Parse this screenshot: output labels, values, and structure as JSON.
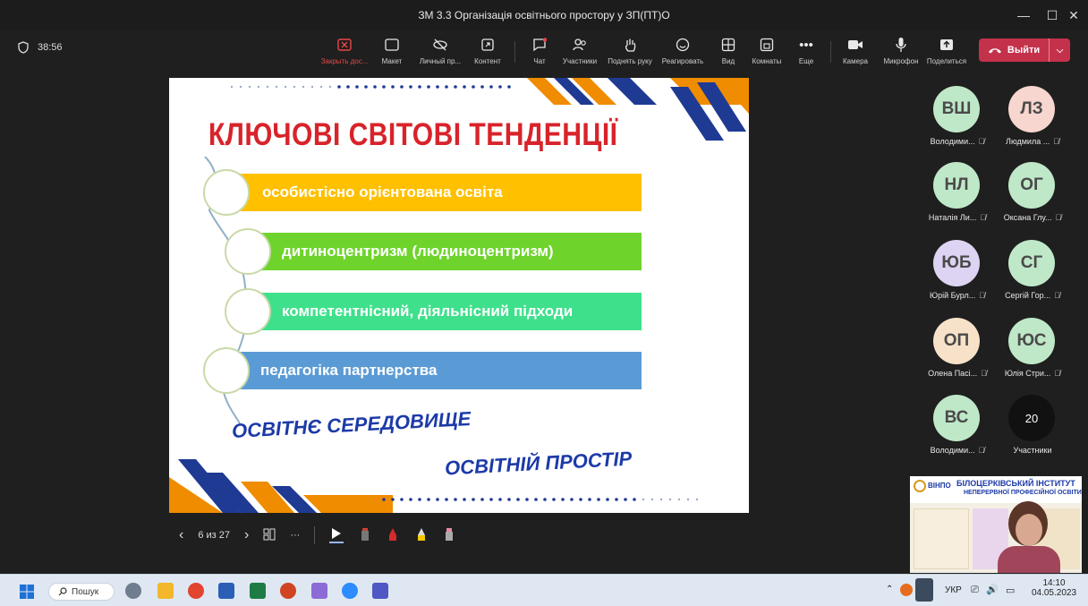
{
  "window": {
    "title": "ЗМ 3.3 Організація освітнього простору у ЗП(ПТ)О",
    "controls": [
      "—",
      "☐",
      "✕"
    ]
  },
  "toolbar": {
    "timer": "38:56",
    "buttons": [
      {
        "label": "Закрыть дос...",
        "icon": "close-share-icon"
      },
      {
        "label": "Макет",
        "icon": "layout-icon"
      },
      {
        "label": "Личный пр...",
        "icon": "eye-off-icon"
      },
      {
        "label": "Контент",
        "icon": "content-icon"
      },
      {
        "label": "Чат",
        "icon": "chat-icon"
      },
      {
        "label": "Участники",
        "icon": "participants-icon"
      },
      {
        "label": "Поднять руку",
        "icon": "hand-icon"
      },
      {
        "label": "Реагировать",
        "icon": "smile-icon"
      },
      {
        "label": "Вид",
        "icon": "grid-icon"
      },
      {
        "label": "Комнаты",
        "icon": "rooms-icon"
      },
      {
        "label": "Еще",
        "icon": "more-icon"
      },
      {
        "label": "Камера",
        "icon": "camera-icon"
      },
      {
        "label": "Микрофон",
        "icon": "mic-icon"
      },
      {
        "label": "Поделиться",
        "icon": "share-icon"
      }
    ],
    "leave_label": "Выйти"
  },
  "slide": {
    "heading": "КЛЮЧОВІ СВІТОВІ ТЕНДЕНЦІЇ",
    "items": [
      {
        "text": "особистісно орієнтована освіта",
        "color": "#ffc000"
      },
      {
        "text": "дитиноцентризм (людиноцентризм)",
        "color": "#6ed42c"
      },
      {
        "text": "компетентнісний, діяльнісний підходи",
        "color": "#3fe08c"
      },
      {
        "text": "педагогіка партнерства",
        "color": "#5b9bd5"
      }
    ],
    "phrase1": "ОСВІТНЄ СЕРЕДОВИЩЕ",
    "phrase2": "ОСВІТНІЙ ПРОСТІР"
  },
  "slide_controls": {
    "page": "6 из 27"
  },
  "participants": [
    {
      "initials": "ВШ",
      "name": "Володими...",
      "color": "#bfe8c8"
    },
    {
      "initials": "ЛЗ",
      "name": "Людмила ...",
      "color": "#f7d6cf"
    },
    {
      "initials": "НЛ",
      "name": "Наталія Ли...",
      "color": "#bfe8c8"
    },
    {
      "initials": "ОГ",
      "name": "Оксана Глу...",
      "color": "#bfe8c8"
    },
    {
      "initials": "ЮБ",
      "name": "Юрій Бурл...",
      "color": "#ddd3f2"
    },
    {
      "initials": "СГ",
      "name": "Сергій Гор...",
      "color": "#bfe8c8"
    },
    {
      "initials": "ОП",
      "name": "Олена Пасі...",
      "color": "#f7e2c9"
    },
    {
      "initials": "ЮС",
      "name": "Юлія Стри...",
      "color": "#bfe8c8"
    },
    {
      "initials": "ВС",
      "name": "Володими...",
      "color": "#bfe8c8"
    },
    {
      "initials": "20",
      "name": "Участники",
      "color": "#111111"
    }
  ],
  "video_tile": {
    "logo": "ВІНПО",
    "institute_line1": "БІЛОЦЕРКІВСЬКИЙ ІНСТИТУТ",
    "institute_line2": "НЕПЕРЕРВНОЇ ПРОФЕСІЙНОЇ ОСВІТИ"
  },
  "taskbar": {
    "search_label": "Пошук",
    "language": "УКР",
    "time": "14:10",
    "date": "04.05.2023"
  }
}
